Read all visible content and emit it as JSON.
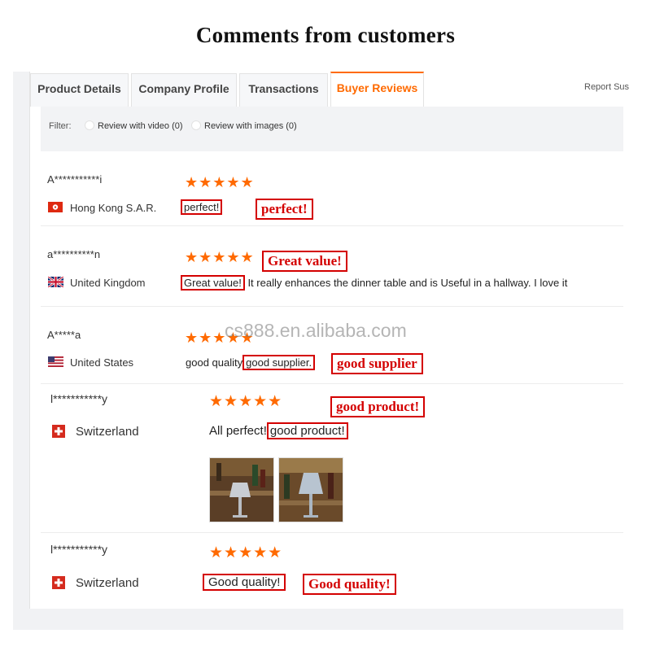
{
  "headline": "Comments from customers",
  "tabs": [
    {
      "label": "Product Details"
    },
    {
      "label": "Company Profile"
    },
    {
      "label": "Transactions"
    },
    {
      "label": "Buyer Reviews",
      "active": true
    }
  ],
  "report_link": "Report Sus",
  "filter": {
    "label": "Filter:",
    "options": [
      "Review with video (0)",
      "Review with images (0)"
    ]
  },
  "watermark": "cs888.en.alibaba.com",
  "accent_color": "#ff6a00",
  "highlight_color": "#d40000",
  "reviews": [
    {
      "name": "A***********i",
      "rating": 5,
      "country": "Hong Kong S.A.R.",
      "flag": "hong-kong-flag",
      "text_before": "",
      "text_boxed": "perfect!",
      "text_after": "",
      "callout": "perfect!"
    },
    {
      "name": "a**********n",
      "rating": 5,
      "country": "United Kingdom",
      "flag": "uk-flag",
      "text_before": "",
      "text_boxed": "Great value!",
      "text_after": " It really enhances the dinner table and is Useful in a hallway. I love it",
      "callout": "Great value!"
    },
    {
      "name": "A*****a",
      "rating": 5,
      "country": "United States",
      "flag": "us-flag",
      "text_before": "good quality",
      "text_boxed": "good supplier.",
      "text_after": "",
      "callout": "good supplier"
    },
    {
      "name": "l***********y",
      "rating": 5,
      "country": "Switzerland",
      "flag": "swiss-flag",
      "text_before": "All perfect!",
      "text_boxed": "good product!",
      "text_after": "",
      "callout": "good product!"
    },
    {
      "name": "l***********y",
      "rating": 5,
      "country": "Switzerland",
      "flag": "swiss-flag",
      "text_before": "",
      "text_boxed": "Good quality!",
      "text_after": "",
      "callout": "Good quality!"
    }
  ]
}
